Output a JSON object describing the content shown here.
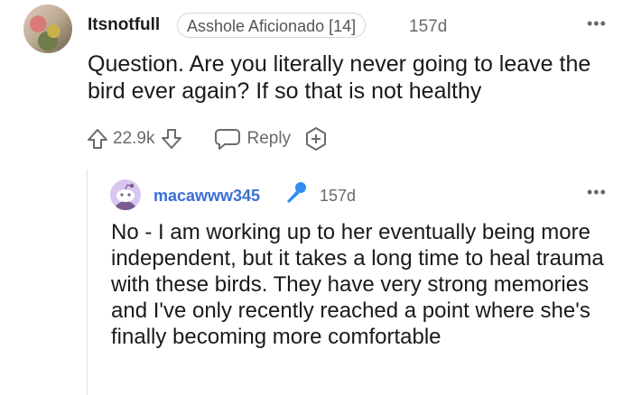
{
  "comment": {
    "author": "Itsnotfull",
    "flair": "Asshole Aficionado [14]",
    "age": "157d",
    "more": "•••",
    "body": "Question. Are you literally never going to leave the bird ever again? If so that is not healthy",
    "actions": {
      "score": "22.9k",
      "reply_label": "Reply"
    }
  },
  "reply": {
    "author": "macawww345",
    "age": "157d",
    "more": "•••",
    "body": "No - I am working up to her eventually being more independent, but it takes a long time to heal trauma with these birds. They have very strong memories and I've only recently reached a point where she's finally becoming more comfortable"
  },
  "colors": {
    "username_link": "#3b6fd1",
    "mic_icon": "#2f8ef0",
    "avatar_bg": "#d9c6f0",
    "meta_text": "#6a6a6a"
  },
  "icons": [
    "more-options-icon",
    "upvote-icon",
    "downvote-icon",
    "reply-bubble-icon",
    "award-plus-icon",
    "microphone-icon"
  ]
}
